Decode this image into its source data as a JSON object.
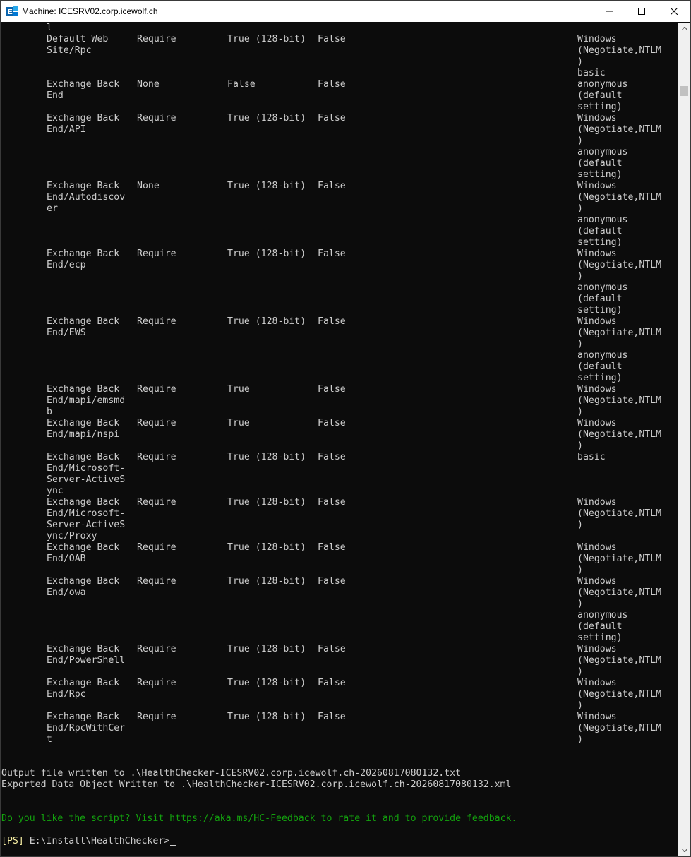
{
  "window": {
    "title": "Machine: ICESRV02.corp.icewolf.ch",
    "icon": "exchange-management-shell-icon",
    "controls": [
      "minimize-icon",
      "maximize-icon",
      "close-icon"
    ]
  },
  "terminal": {
    "top_fragment": "l",
    "rows": [
      {
        "name": "default-web-site-rpc",
        "site": [
          "Default Web",
          "Site/Rpc"
        ],
        "ssl": "Require",
        "encrypt": "True (128-bit)",
        "client": "False",
        "auth": [
          "Windows",
          "(Negotiate,NTLM",
          ")",
          "basic"
        ]
      },
      {
        "name": "exchange-back-end",
        "site": [
          "Exchange Back",
          "End"
        ],
        "ssl": "None",
        "encrypt": "False",
        "client": "False",
        "auth": [
          "anonymous",
          "(default",
          "setting)"
        ]
      },
      {
        "name": "exchange-back-end-api",
        "site": [
          "Exchange Back",
          "End/API"
        ],
        "ssl": "Require",
        "encrypt": "True (128-bit)",
        "client": "False",
        "auth": [
          "Windows",
          "(Negotiate,NTLM",
          ")",
          "anonymous",
          "(default",
          "setting)"
        ]
      },
      {
        "name": "exchange-back-end-autodiscover",
        "site": [
          "Exchange Back",
          "End/Autodiscov",
          "er"
        ],
        "ssl": "None",
        "encrypt": "True (128-bit)",
        "client": "False",
        "auth": [
          "Windows",
          "(Negotiate,NTLM",
          ")",
          "anonymous",
          "(default",
          "setting)"
        ]
      },
      {
        "name": "exchange-back-end-ecp",
        "site": [
          "Exchange Back",
          "End/ecp"
        ],
        "ssl": "Require",
        "encrypt": "True (128-bit)",
        "client": "False",
        "auth": [
          "Windows",
          "(Negotiate,NTLM",
          ")",
          "anonymous",
          "(default",
          "setting)"
        ]
      },
      {
        "name": "exchange-back-end-ews",
        "site": [
          "Exchange Back",
          "End/EWS"
        ],
        "ssl": "Require",
        "encrypt": "True (128-bit)",
        "client": "False",
        "auth": [
          "Windows",
          "(Negotiate,NTLM",
          ")",
          "anonymous",
          "(default",
          "setting)"
        ]
      },
      {
        "name": "exchange-back-end-mapi-emsmdb",
        "site": [
          "Exchange Back",
          "End/mapi/emsmd",
          "b"
        ],
        "ssl": "Require",
        "encrypt": "True",
        "client": "False",
        "auth": [
          "Windows",
          "(Negotiate,NTLM",
          ")"
        ]
      },
      {
        "name": "exchange-back-end-mapi-nspi",
        "site": [
          "Exchange Back",
          "End/mapi/nspi"
        ],
        "ssl": "Require",
        "encrypt": "True",
        "client": "False",
        "auth": [
          "Windows",
          "(Negotiate,NTLM",
          ")"
        ]
      },
      {
        "name": "exchange-back-end-activesync",
        "site": [
          "Exchange Back",
          "End/Microsoft-",
          "Server-ActiveS",
          "ync"
        ],
        "ssl": "Require",
        "encrypt": "True (128-bit)",
        "client": "False",
        "auth": [
          "basic"
        ]
      },
      {
        "name": "exchange-back-end-activesync-proxy",
        "site": [
          "Exchange Back",
          "End/Microsoft-",
          "Server-ActiveS",
          "ync/Proxy"
        ],
        "ssl": "Require",
        "encrypt": "True (128-bit)",
        "client": "False",
        "auth": [
          "Windows",
          "(Negotiate,NTLM",
          ")"
        ]
      },
      {
        "name": "exchange-back-end-oab",
        "site": [
          "Exchange Back",
          "End/OAB"
        ],
        "ssl": "Require",
        "encrypt": "True (128-bit)",
        "client": "False",
        "auth": [
          "Windows",
          "(Negotiate,NTLM",
          ")"
        ]
      },
      {
        "name": "exchange-back-end-owa",
        "site": [
          "Exchange Back",
          "End/owa"
        ],
        "ssl": "Require",
        "encrypt": "True (128-bit)",
        "client": "False",
        "auth": [
          "Windows",
          "(Negotiate,NTLM",
          ")",
          "anonymous",
          "(default",
          "setting)"
        ]
      },
      {
        "name": "exchange-back-end-powershell",
        "site": [
          "Exchange Back",
          "End/PowerShell"
        ],
        "ssl": "Require",
        "encrypt": "True (128-bit)",
        "client": "False",
        "auth": [
          "Windows",
          "(Negotiate,NTLM",
          ")"
        ]
      },
      {
        "name": "exchange-back-end-rpc",
        "site": [
          "Exchange Back",
          "End/Rpc"
        ],
        "ssl": "Require",
        "encrypt": "True (128-bit)",
        "client": "False",
        "auth": [
          "Windows",
          "(Negotiate,NTLM",
          ")"
        ]
      },
      {
        "name": "exchange-back-end-rpcwithcert",
        "site": [
          "Exchange Back",
          "End/RpcWithCer",
          "t"
        ],
        "ssl": "Require",
        "encrypt": "True (128-bit)",
        "client": "False",
        "auth": [
          "Windows",
          "(Negotiate,NTLM",
          ")"
        ]
      }
    ],
    "output_lines": [
      "Output file written to .\\HealthChecker-ICESRV02.corp.icewolf.ch-20260817080132.txt",
      "Exported Data Object Written to .\\HealthChecker-ICESRV02.corp.icewolf.ch-20260817080132.xml"
    ],
    "feedback": "Do you like the script? Visit https://aka.ms/HC-Feedback to rate it and to provide feedback.",
    "prompt_tag": "[PS]",
    "prompt_path": " E:\\Install\\HealthChecker>"
  },
  "colors": {
    "background": "#0c0c0c",
    "text": "#cccccc",
    "feedback": "#13a10e",
    "prompt": "#f9f1a5"
  }
}
